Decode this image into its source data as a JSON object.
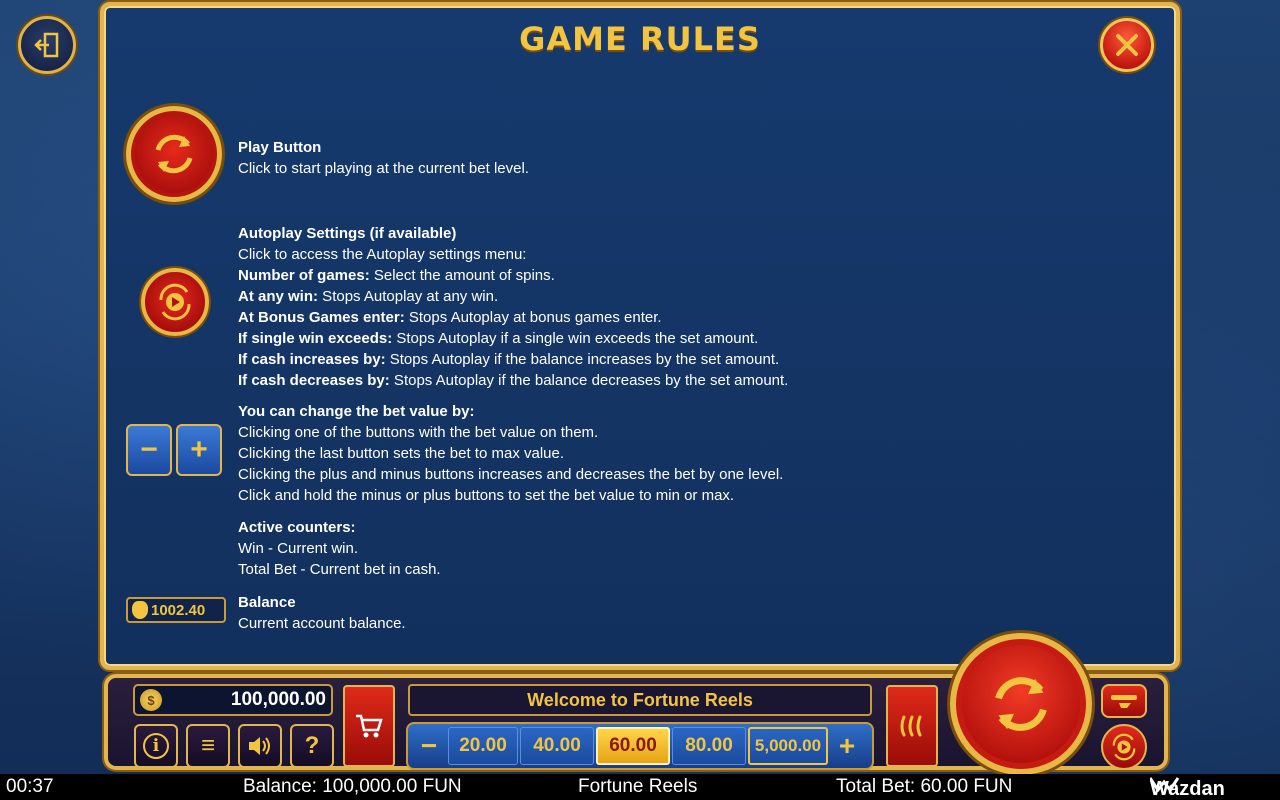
{
  "panel": {
    "title": "GAME RULES",
    "sections": {
      "play": {
        "heading": "Play Button",
        "lines": [
          "Click to start playing at the current bet level."
        ]
      },
      "autoplay": {
        "heading": "Autoplay Settings (if available)",
        "intro": "Click to access the Autoplay settings menu:",
        "items": [
          {
            "label": "Number of games:",
            "text": " Select the amount of spins."
          },
          {
            "label": "At any win:",
            "text": " Stops Autoplay at any win."
          },
          {
            "label": "At Bonus Games enter:",
            "text": " Stops Autoplay at bonus games enter."
          },
          {
            "label": "If single win exceeds:",
            "text": " Stops Autoplay if a single win exceeds the set amount."
          },
          {
            "label": "If cash increases by:",
            "text": " Stops Autoplay if the balance increases by the set amount."
          },
          {
            "label": "If cash decreases by:",
            "text": " Stops Autoplay if the balance decreases by the set amount."
          }
        ]
      },
      "bet": {
        "heading": "You can change the bet value by:",
        "lines": [
          "Clicking one of the buttons with the bet value on them.",
          "Clicking the last button sets the bet to max value.",
          "Clicking the plus and minus buttons increases and decreases the bet by one level.",
          "Click and hold the minus or plus buttons to set the bet value to min or max."
        ],
        "minus_glyph": "−",
        "plus_glyph": "+"
      },
      "counters": {
        "heading": "Active counters:",
        "lines": [
          "Win - Current win.",
          "Total Bet - Current bet in cash."
        ]
      },
      "balance": {
        "heading": "Balance",
        "lines": [
          "Current account balance."
        ],
        "icon_value": "1002.40"
      }
    }
  },
  "controls": {
    "balance_value": "100,000.00",
    "coin_glyph": "$",
    "info_glyph": "i",
    "menu_glyph": "≡",
    "help_glyph": "?",
    "welcome_text": "Welcome to Fortune Reels",
    "bet_minus": "−",
    "bet_plus": "+",
    "bet_values": [
      "20.00",
      "40.00",
      "60.00",
      "80.00",
      "5,000.00"
    ],
    "selected_bet_index": 2
  },
  "status": {
    "time": "00:37",
    "balance": "Balance: 100,000.00 FUN",
    "game": "Fortune Reels",
    "total_bet": "Total Bet: 60.00 FUN",
    "brand": "Wazdan"
  },
  "colors": {
    "gold": "#f2c541",
    "red": "#c21710",
    "panel_blue": "#12305d"
  }
}
